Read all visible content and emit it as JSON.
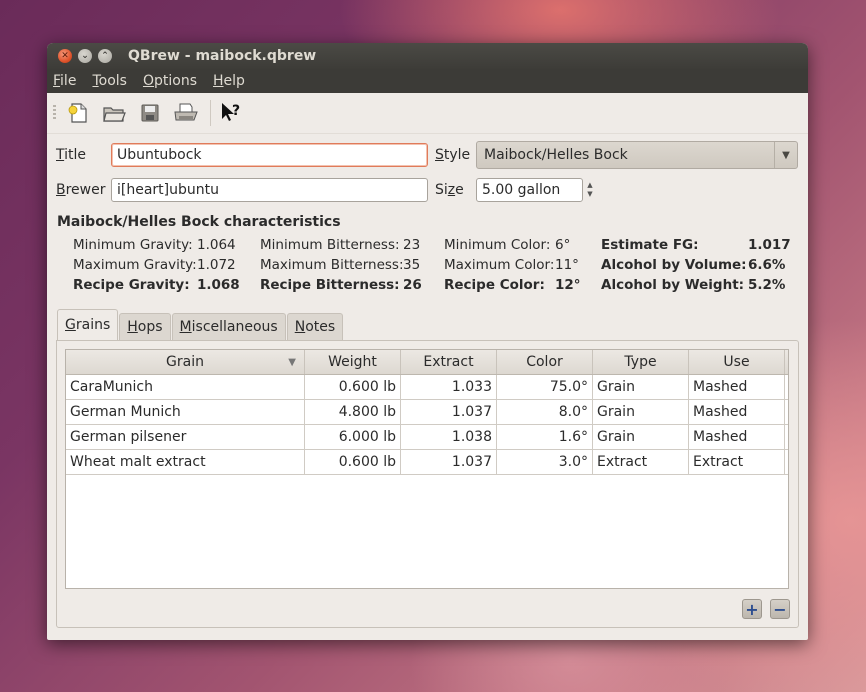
{
  "window": {
    "title": "QBrew - maibock.qbrew"
  },
  "menu": [
    {
      "label": "File",
      "mnemonic": "F",
      "rest": "ile"
    },
    {
      "label": "Tools",
      "mnemonic": "T",
      "rest": "ools"
    },
    {
      "label": "Options",
      "mnemonic": "O",
      "rest": "ptions"
    },
    {
      "label": "Help",
      "mnemonic": "H",
      "rest": "elp"
    }
  ],
  "toolbar": [
    "new-icon",
    "open-icon",
    "save-icon",
    "print-icon",
    "whats-this-icon"
  ],
  "form": {
    "title_label_m": "T",
    "title_label_rest": "itle",
    "title_value": "Ubuntubock",
    "style_label_m": "S",
    "style_label_rest": "tyle",
    "style_value": "Maibock/Helles Bock",
    "brewer_label_m": "B",
    "brewer_label_rest": "rewer",
    "brewer_value": "i[heart]ubuntu",
    "size_label_pre": "Si",
    "size_label_m": "z",
    "size_label_rest": "e",
    "size_value": "5.00 gallon"
  },
  "characteristics": {
    "heading": "Maibock/Helles Bock characteristics",
    "gravity": {
      "min_label": "Minimum Gravity:",
      "min": "1.064",
      "max_label": "Maximum Gravity:",
      "max": "1.072",
      "recipe_label": "Recipe Gravity:",
      "recipe": "1.068"
    },
    "bitterness": {
      "min_label": "Minimum Bitterness:",
      "min": "23",
      "max_label": "Maximum Bitterness:",
      "max": "35",
      "recipe_label": "Recipe Bitterness:",
      "recipe": "26"
    },
    "color": {
      "min_label": "Minimum Color:",
      "min": "6°",
      "max_label": "Maximum Color:",
      "max": "11°",
      "recipe_label": "Recipe Color:",
      "recipe": "12°"
    },
    "estimates": {
      "fg_label": "Estimate FG:",
      "fg": "1.017",
      "abv_label": "Alcohol by Volume:",
      "abv": "6.6%",
      "abw_label": "Alcohol by Weight:",
      "abw": "5.2%"
    }
  },
  "tabs": [
    {
      "label": "Grains",
      "m": "G",
      "rest": "rains",
      "active": true
    },
    {
      "label": "Hops",
      "m": "H",
      "rest": "ops",
      "active": false
    },
    {
      "label": "Miscellaneous",
      "m": "M",
      "rest": "iscellaneous",
      "active": false
    },
    {
      "label": "Notes",
      "m": "N",
      "rest": "otes",
      "active": false
    }
  ],
  "grains_table": {
    "columns": [
      "Grain",
      "Weight",
      "Extract",
      "Color",
      "Type",
      "Use"
    ],
    "rows": [
      [
        "CaraMunich",
        "0.600 lb",
        "1.033",
        "75.0°",
        "Grain",
        "Mashed"
      ],
      [
        "German Munich",
        "4.800 lb",
        "1.037",
        "8.0°",
        "Grain",
        "Mashed"
      ],
      [
        "German pilsener",
        "6.000 lb",
        "1.038",
        "1.6°",
        "Grain",
        "Mashed"
      ],
      [
        "Wheat malt extract",
        "0.600 lb",
        "1.037",
        "3.0°",
        "Extract",
        "Extract"
      ]
    ]
  },
  "buttons": {
    "add": "+",
    "remove": "−"
  }
}
